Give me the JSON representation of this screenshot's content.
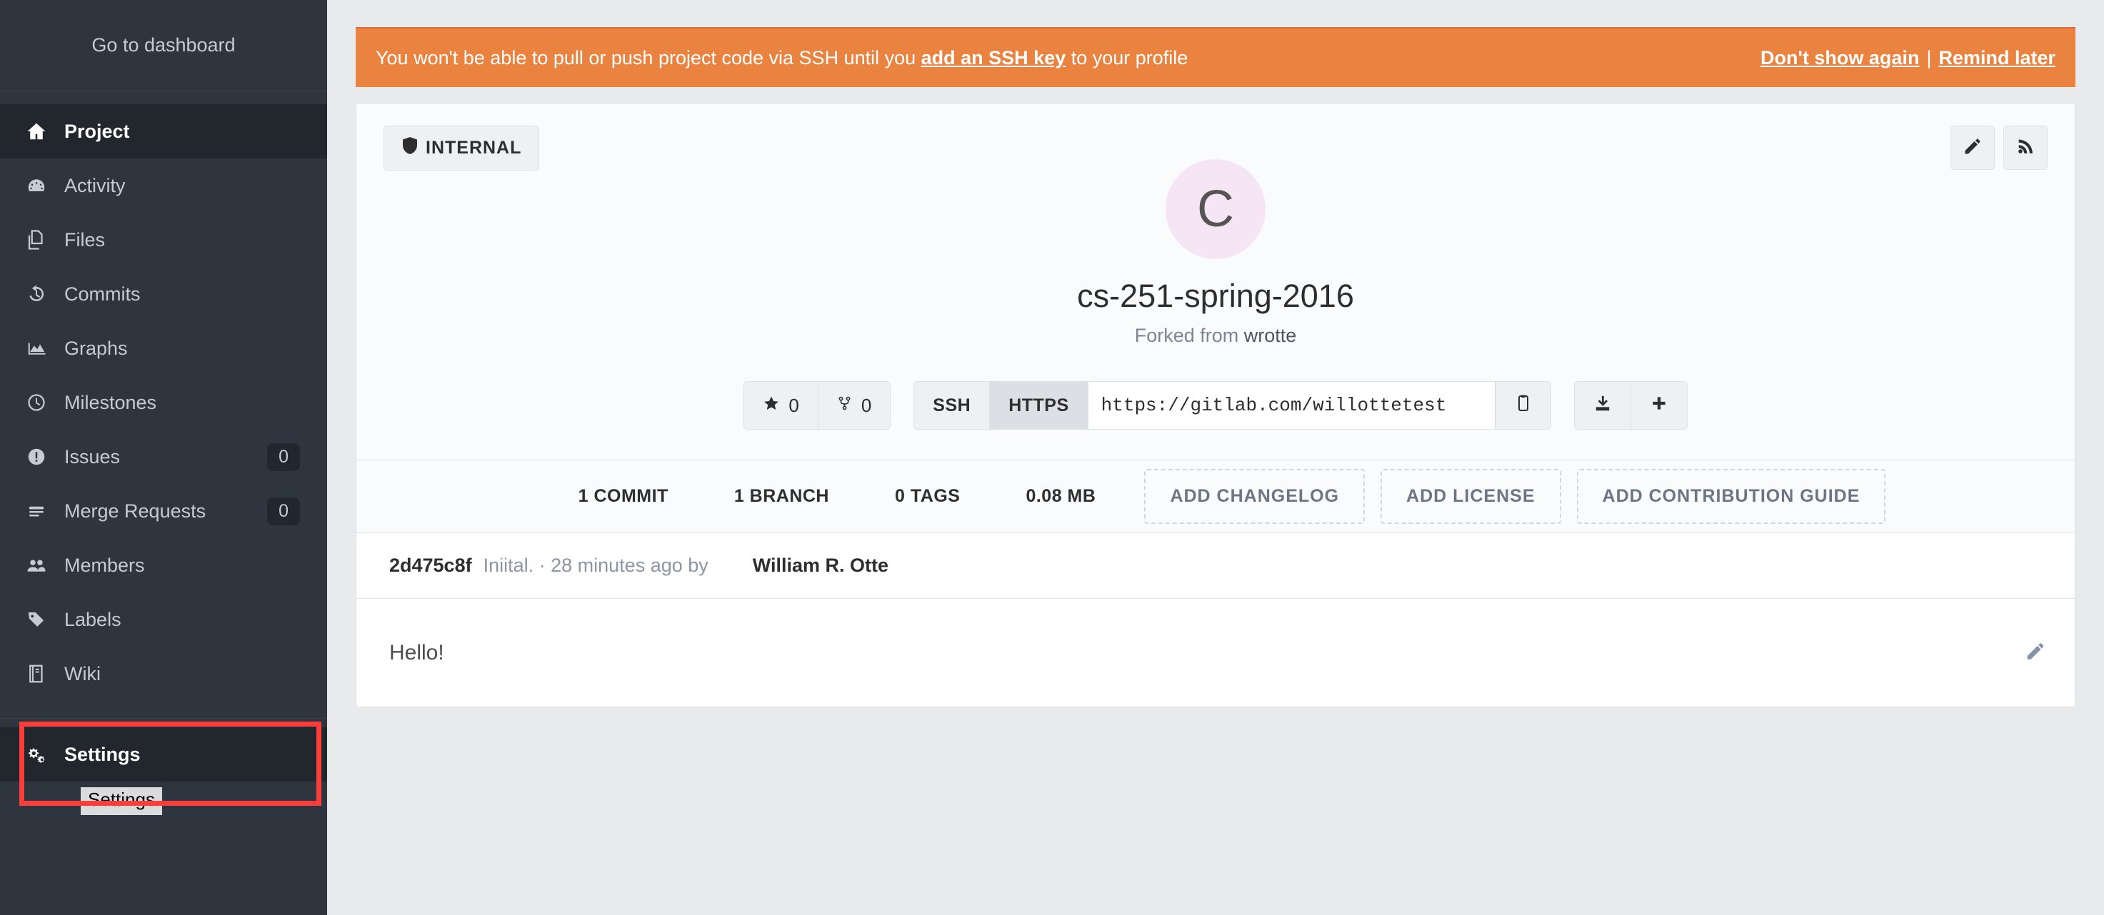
{
  "sidebar": {
    "dashboard_link": "Go to dashboard",
    "items": [
      {
        "label": "Project",
        "icon": "home-icon",
        "badge": null,
        "active": true
      },
      {
        "label": "Activity",
        "icon": "dashboard-icon",
        "badge": null,
        "active": false
      },
      {
        "label": "Files",
        "icon": "files-icon",
        "badge": null,
        "active": false
      },
      {
        "label": "Commits",
        "icon": "history-icon",
        "badge": null,
        "active": false
      },
      {
        "label": "Graphs",
        "icon": "chart-area-icon",
        "badge": null,
        "active": false
      },
      {
        "label": "Milestones",
        "icon": "clock-icon",
        "badge": null,
        "active": false
      },
      {
        "label": "Issues",
        "icon": "exclamation-icon",
        "badge": "0",
        "active": false
      },
      {
        "label": "Merge Requests",
        "icon": "merge-request-icon",
        "badge": "0",
        "active": false
      },
      {
        "label": "Members",
        "icon": "users-icon",
        "badge": null,
        "active": false
      },
      {
        "label": "Labels",
        "icon": "tag-icon",
        "badge": null,
        "active": false
      },
      {
        "label": "Wiki",
        "icon": "book-icon",
        "badge": null,
        "active": false
      }
    ],
    "settings": {
      "label": "Settings",
      "icon": "gears-icon"
    },
    "settings_tooltip": "Settings"
  },
  "banner": {
    "message_prefix": "You won't be able to pull or push project code via SSH until you ",
    "link_text": "add an SSH key",
    "message_suffix": " to your profile",
    "dont_show_again": "Don't show again",
    "separator": "|",
    "remind_later": "Remind later",
    "background_color": "#e9833f"
  },
  "project": {
    "visibility_badge": "INTERNAL",
    "avatar_initial": "C",
    "avatar_color": "#f6e6f5",
    "name": "cs-251-spring-2016",
    "forked_from_prefix": "Forked from ",
    "forked_from_parent": "wrotte",
    "edit_button_icon": "pencil-icon",
    "rss_button_icon": "rss-icon"
  },
  "clone": {
    "star_count": "0",
    "fork_count": "0",
    "protocols": [
      {
        "label": "SSH",
        "active": false
      },
      {
        "label": "HTTPS",
        "active": true
      }
    ],
    "url": "https://gitlab.com/willottetest",
    "copy_icon": "clipboard-icon",
    "download_icon": "download-icon",
    "plus_icon": "plus-icon"
  },
  "stats": {
    "items": [
      {
        "label": "1 COMMIT"
      },
      {
        "label": "1 BRANCH"
      },
      {
        "label": "0 TAGS"
      },
      {
        "label": "0.08 MB"
      }
    ],
    "add_buttons": [
      {
        "label": "ADD CHANGELOG"
      },
      {
        "label": "ADD LICENSE"
      },
      {
        "label": "ADD CONTRIBUTION GUIDE"
      }
    ]
  },
  "commit": {
    "sha": "2d475c8f",
    "message": "Iniital. · 28 minutes ago by",
    "author": "William R. Otte"
  },
  "readme": {
    "content": "Hello!",
    "edit_icon": "pencil-icon"
  },
  "annotation": {
    "color": "#fc3d39",
    "target": "sidebar-item-settings"
  }
}
